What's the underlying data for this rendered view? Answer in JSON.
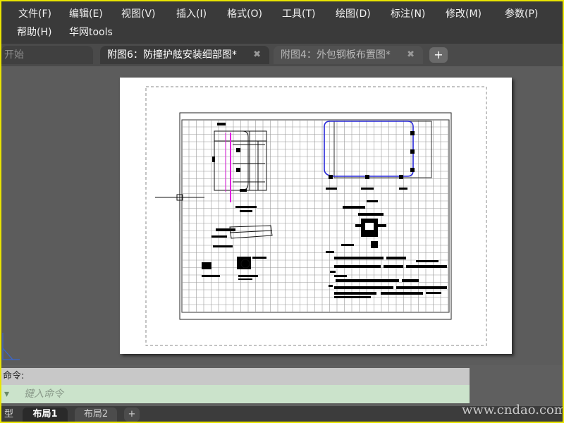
{
  "menubar": {
    "items": [
      "文件(F)",
      "编辑(E)",
      "视图(V)",
      "插入(I)",
      "格式(O)",
      "工具(T)",
      "绘图(D)",
      "标注(N)",
      "修改(M)",
      "参数(P)",
      "帮助(H)",
      "华网tools"
    ]
  },
  "tabs": {
    "start": "开始",
    "active": "附图6：防撞护舷安装细部图*",
    "inactive": "附图4：外包钢板布置图*",
    "close_glyph": "✖",
    "add_glyph": "+"
  },
  "command": {
    "history": "命令:",
    "placeholder": "键入命令"
  },
  "layout_tabs": {
    "model": "型",
    "items": [
      "布局1",
      "布局2"
    ],
    "add": "+"
  },
  "watermark": "www.cndao.com",
  "colors": {
    "menubar_bg": "#3a3a3a",
    "workspace_bg": "#5c5c5c",
    "paper": "#ffffff",
    "grid": "#9a9a9a",
    "blue_outline": "#2828d8",
    "magenta_line": "#e020e0",
    "command_input_bg": "#cbe3cb",
    "border_highlight": "#e8e400"
  }
}
